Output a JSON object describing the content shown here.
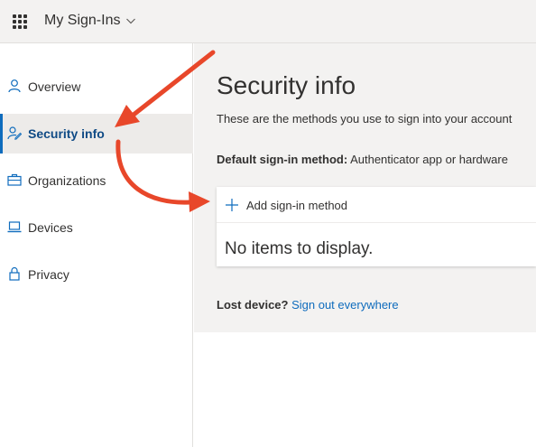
{
  "app": {
    "title": "My Sign-Ins"
  },
  "sidebar": {
    "items": [
      {
        "label": "Overview",
        "icon": "person-icon",
        "active": false
      },
      {
        "label": "Security info",
        "icon": "security-info-icon",
        "active": true
      },
      {
        "label": "Organizations",
        "icon": "briefcase-icon",
        "active": false
      },
      {
        "label": "Devices",
        "icon": "laptop-icon",
        "active": false
      },
      {
        "label": "Privacy",
        "icon": "lock-icon",
        "active": false
      }
    ]
  },
  "main": {
    "title": "Security info",
    "subtitle": "These are the methods you use to sign into your account",
    "default_method_label": "Default sign-in method:",
    "default_method_value": "Authenticator app or hardware",
    "add_method_label": "Add sign-in method",
    "empty_text": "No items to display.",
    "lost_device_label": "Lost device?",
    "sign_out_link": "Sign out everywhere"
  },
  "colors": {
    "accent": "#0f6cbd",
    "annotation_arrow": "#e8472a",
    "page_background": "#f3f2f1"
  }
}
